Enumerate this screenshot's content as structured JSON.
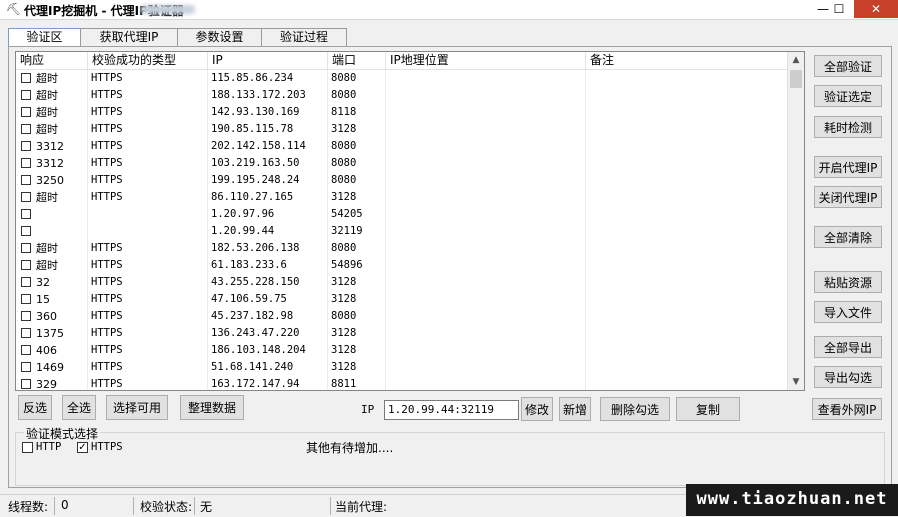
{
  "window": {
    "title": "代理IP挖掘机  -       代理IP验证器",
    "min": "—",
    "max": "☐",
    "close": "✕"
  },
  "tabs": [
    "验证区",
    "获取代理IP",
    "参数设置",
    "验证过程"
  ],
  "list": {
    "headers": [
      "响应",
      "校验成功的类型",
      "IP",
      "端口",
      "IP地理位置",
      "备注"
    ],
    "rows": [
      {
        "resp": "超时",
        "type": "HTTPS",
        "ip": "115.85.86.234",
        "port": "8080"
      },
      {
        "resp": "超时",
        "type": "HTTPS",
        "ip": "188.133.172.203",
        "port": "8080"
      },
      {
        "resp": "超时",
        "type": "HTTPS",
        "ip": "142.93.130.169",
        "port": "8118"
      },
      {
        "resp": "超时",
        "type": "HTTPS",
        "ip": "190.85.115.78",
        "port": "3128"
      },
      {
        "resp": "3312",
        "type": "HTTPS",
        "ip": "202.142.158.114",
        "port": "8080"
      },
      {
        "resp": "3312",
        "type": "HTTPS",
        "ip": "103.219.163.50",
        "port": "8080"
      },
      {
        "resp": "3250",
        "type": "HTTPS",
        "ip": "199.195.248.24",
        "port": "8080"
      },
      {
        "resp": "超时",
        "type": "HTTPS",
        "ip": "86.110.27.165",
        "port": "3128"
      },
      {
        "resp": "",
        "type": "",
        "ip": "1.20.97.96",
        "port": "54205"
      },
      {
        "resp": "",
        "type": "",
        "ip": "1.20.99.44",
        "port": "32119"
      },
      {
        "resp": "超时",
        "type": "HTTPS",
        "ip": "182.53.206.138",
        "port": "8080"
      },
      {
        "resp": "超时",
        "type": "HTTPS",
        "ip": "61.183.233.6",
        "port": "54896"
      },
      {
        "resp": "32",
        "type": "HTTPS",
        "ip": "43.255.228.150",
        "port": "3128"
      },
      {
        "resp": "15",
        "type": "HTTPS",
        "ip": "47.106.59.75",
        "port": "3128"
      },
      {
        "resp": "360",
        "type": "HTTPS",
        "ip": "45.237.182.98",
        "port": "8080"
      },
      {
        "resp": "1375",
        "type": "HTTPS",
        "ip": "136.243.47.220",
        "port": "3128"
      },
      {
        "resp": "406",
        "type": "HTTPS",
        "ip": "186.103.148.204",
        "port": "3128"
      },
      {
        "resp": "1469",
        "type": "HTTPS",
        "ip": "51.68.141.240",
        "port": "3128"
      },
      {
        "resp": "329",
        "type": "HTTPS",
        "ip": "163.172.147.94",
        "port": "8811"
      }
    ]
  },
  "side_buttons": [
    "全部验证",
    "验证选定",
    "耗时检测",
    "开启代理IP",
    "关闭代理IP",
    "全部清除",
    "粘贴资源",
    "导入文件",
    "全部导出",
    "导出勾选",
    "查看外网IP"
  ],
  "bottom": {
    "invert": "反选",
    "select_all": "全选",
    "select_usable": "选择可用",
    "tidy": "整理数据",
    "ip_label": "IP",
    "ip_value": "1.20.99.44:32119",
    "modify": "修改",
    "add": "新增",
    "delete_checked": "删除勾选",
    "copy": "复制"
  },
  "mode": {
    "title": "验证模式选择",
    "http": "HTTP",
    "http_checked": false,
    "https": "HTTPS",
    "https_checked": true,
    "https_mark": "✓",
    "other": "其他有待增加...."
  },
  "status": {
    "threads_label": "线程数:",
    "threads_value": "0",
    "check_label": "校验状态:",
    "check_value": "无",
    "proxy_label": "当前代理:",
    "proxy_value": ""
  },
  "watermark": "www.tiaozhuan.net"
}
